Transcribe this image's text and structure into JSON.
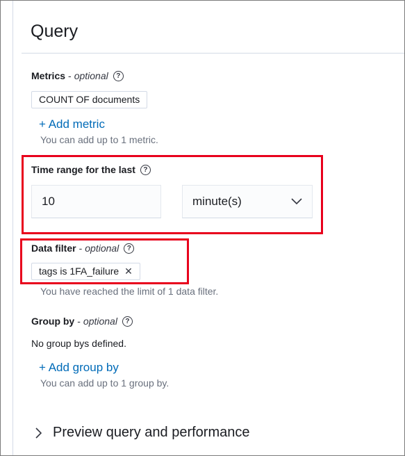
{
  "query": {
    "title": "Query",
    "metrics": {
      "label": "Metrics",
      "optional": "optional",
      "badge": "COUNT OF documents",
      "add_link": "+ Add metric",
      "hint": "You can add up to 1 metric."
    },
    "time_range": {
      "label": "Time range for the last",
      "value": "10",
      "unit": "minute(s)"
    },
    "data_filter": {
      "label": "Data filter",
      "optional": "optional",
      "badge": "tags is 1FA_failure",
      "hint": "You have reached the limit of 1 data filter."
    },
    "group_by": {
      "label": "Group by",
      "optional": "optional",
      "empty_text": "No group bys defined.",
      "add_link": "+ Add group by",
      "hint": "You can add up to 1 group by."
    },
    "preview": {
      "label": "Preview query and performance"
    }
  },
  "icons": {
    "help": "question-circle-icon",
    "close": "close-icon",
    "chevron": "chevron-down-icon",
    "arrow": "arrow-right-icon"
  },
  "colors": {
    "link": "#006bb8",
    "highlight": "#e8001c",
    "hint": "#69707d"
  }
}
